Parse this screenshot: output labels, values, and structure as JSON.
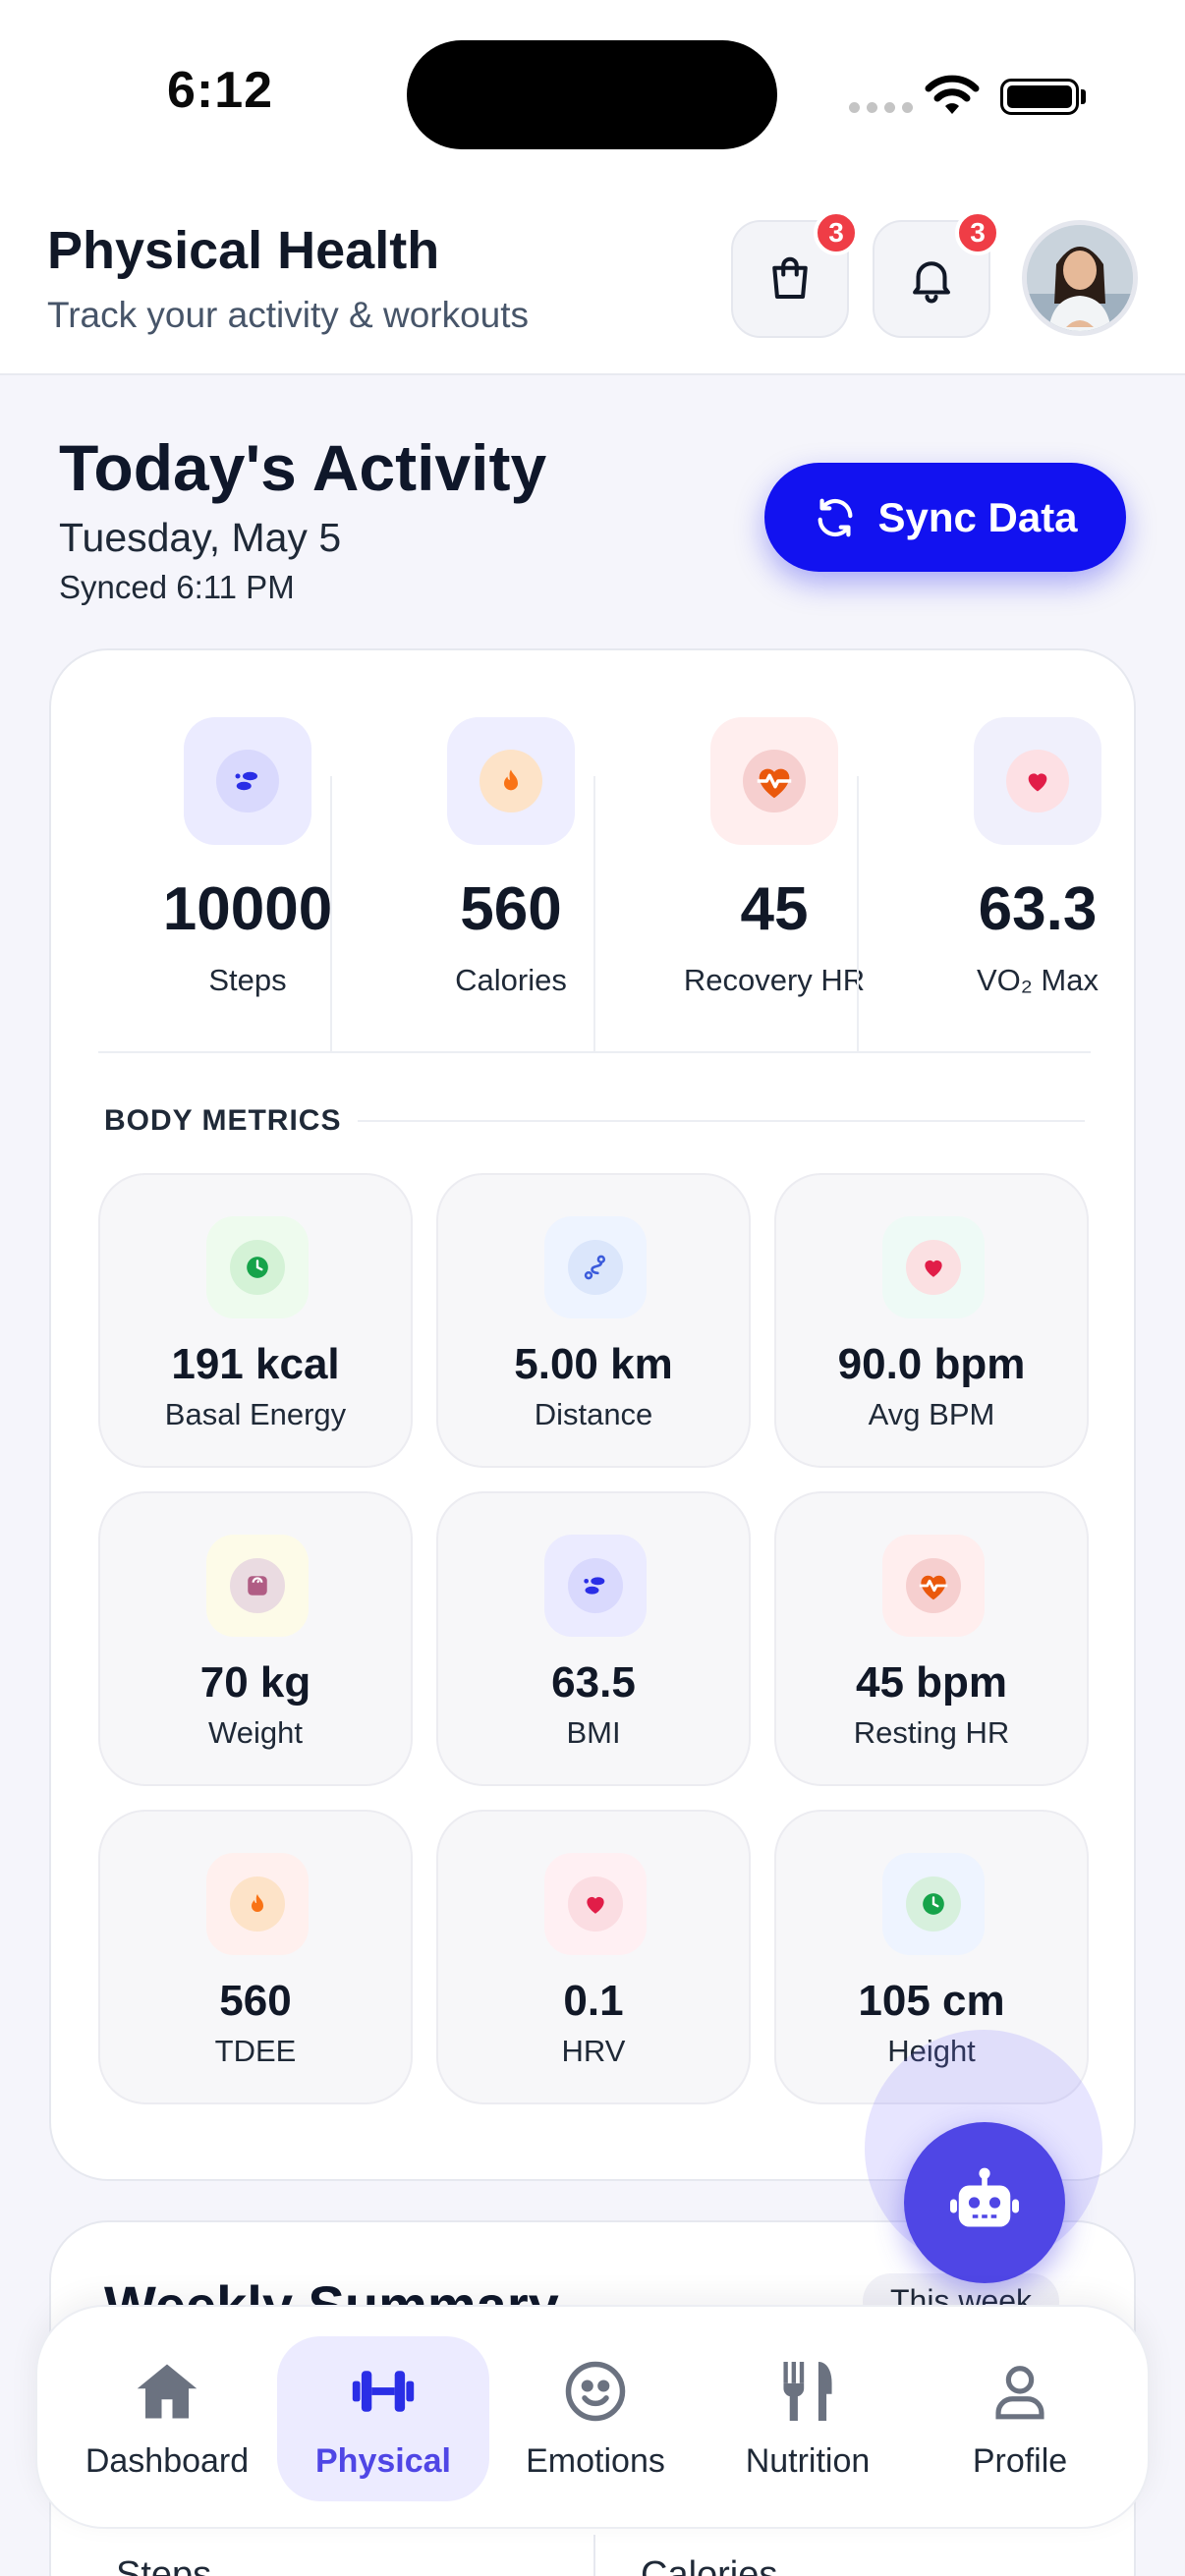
{
  "status_bar": {
    "time": "6:12"
  },
  "header": {
    "title": "Physical Health",
    "subtitle": "Track your activity & workouts",
    "cart_badge": "3",
    "notifications_badge": "3"
  },
  "today": {
    "title": "Today's Activity",
    "date": "Tuesday, May 5",
    "synced": "Synced 6:11 PM",
    "sync_button": "Sync Data"
  },
  "stats": [
    {
      "icon": "footsteps-icon",
      "value": "10000",
      "label": "Steps"
    },
    {
      "icon": "flame-icon",
      "value": "560",
      "label": "Calories"
    },
    {
      "icon": "heart-pulse-icon",
      "value": "45",
      "label": "Recovery HR"
    },
    {
      "icon": "heart-icon",
      "value": "63.3",
      "label": "VO₂ Max"
    }
  ],
  "body_metrics": {
    "title": "BODY METRICS",
    "items": [
      {
        "icon": "clock-icon",
        "value": "191 kcal",
        "label": "Basal Energy"
      },
      {
        "icon": "route-icon",
        "value": "5.00 km",
        "label": "Distance"
      },
      {
        "icon": "heart-icon",
        "value": "90.0 bpm",
        "label": "Avg BPM"
      },
      {
        "icon": "scale-icon",
        "value": "70 kg",
        "label": "Weight"
      },
      {
        "icon": "footsteps-icon",
        "value": "63.5",
        "label": "BMI"
      },
      {
        "icon": "heart-pulse-icon",
        "value": "45 bpm",
        "label": "Resting HR"
      },
      {
        "icon": "flame-icon",
        "value": "560",
        "label": "TDEE"
      },
      {
        "icon": "heart-icon",
        "value": "0.1",
        "label": "HRV"
      },
      {
        "icon": "clock-icon",
        "value": "105 cm",
        "label": "Height"
      }
    ]
  },
  "weekly": {
    "title": "Weekly Summary",
    "chip": "This week",
    "steps_label": "Steps",
    "calories_label": "Calories"
  },
  "nav": [
    {
      "icon": "home-icon",
      "label": "Dashboard",
      "active": false
    },
    {
      "icon": "dumbbell-icon",
      "label": "Physical",
      "active": true
    },
    {
      "icon": "smiley-icon",
      "label": "Emotions",
      "active": false
    },
    {
      "icon": "fork-knife-icon",
      "label": "Nutrition",
      "active": false
    },
    {
      "icon": "person-icon",
      "label": "Profile",
      "active": false
    }
  ],
  "colors": {
    "accent": "#1212f0",
    "nav_active": "#4f46e5",
    "badge": "#ef3d46",
    "fab": "#4f46e5"
  }
}
